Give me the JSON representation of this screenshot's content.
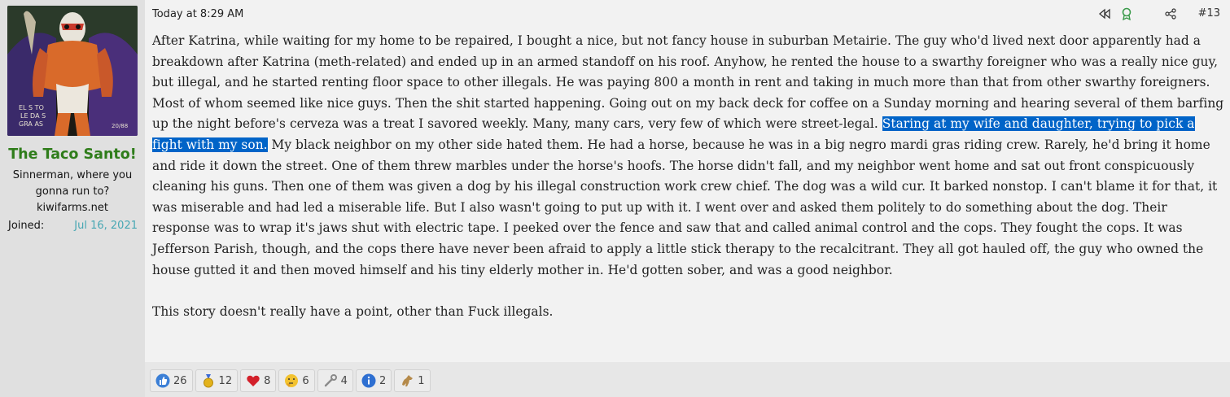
{
  "user": {
    "name": "The Taco Santo!",
    "title": "Sinnerman, where you gonna run to?",
    "banner": "kiwifarms.net",
    "joined_label": "Joined:",
    "joined_date": "Jul 16, 2021",
    "avatar_text": "EL SANTO LE DA LAS GRACIAS",
    "avatar_signature": "20/88"
  },
  "post": {
    "timestamp": "Today at 8:29 AM",
    "number": "#13",
    "icons": [
      "rewind-icon",
      "award-ribbon-icon",
      "share-icon"
    ],
    "text_before": "After Katrina, while waiting for my home to be repaired, I bought a nice, but not fancy house in suburban Metairie. The guy who'd lived next door apparently had a breakdown after Katrina (meth-related) and ended up in an armed standoff on his roof. Anyhow, he rented the house to a swarthy foreigner who was a really nice guy, but illegal, and he started renting floor space to other illegals. He was paying 800 a month in rent and taking in much more than that from other swarthy foreigners. Most of whom seemed like nice guys. Then the shit started happening. Going out on my back deck for coffee on a Sunday morning and hearing several of them barfing up the night before's cerveza was a treat I savored weekly. Many, many cars, very few of which were street-legal. ",
    "text_highlight": "Staring at my wife and daughter, trying to pick a fight with my son.",
    "text_after": " My black neighbor on my other side hated them. He had a horse, because he was in a big negro mardi gras riding crew. Rarely, he'd bring it home and ride it down the street. One of them threw marbles under the horse's hoofs. The horse didn't fall, and my neighbor went home and sat out front conspicuously cleaning his guns. Then one of them was given a dog by his illegal construction work crew chief. The dog was a wild cur. It barked nonstop. I can't blame it for that, it was miserable and had led a miserable life. But I also wasn't going to put up with it. I went over and asked them politely to do something about the dog. Their response was to wrap it's jaws shut with electric tape. I peeked over the fence and saw that and called animal control and the cops. They fought the cops. It was Jefferson Parish, though, and the cops there have never been afraid to apply a little stick therapy to the recalcitrant. They all got hauled off, the guy who owned the house gutted it and then moved himself and his tiny elderly mother in. He'd gotten sober, and was a good neighbor.",
    "closing": "This story doesn't really have a point, other than Fuck illegals."
  },
  "reactions": [
    {
      "icon": "thumbs-up-icon",
      "count": "26",
      "color": "#3b7fd6"
    },
    {
      "icon": "medal-icon",
      "count": "12",
      "color": "#e3b21b"
    },
    {
      "icon": "heart-icon",
      "count": "8",
      "color": "#d3202a"
    },
    {
      "icon": "thinking-face-icon",
      "count": "6",
      "color": "#f2c230"
    },
    {
      "icon": "wrench-icon",
      "count": "4",
      "color": "#8a8a8a"
    },
    {
      "icon": "info-icon",
      "count": "2",
      "color": "#2e6fd1"
    },
    {
      "icon": "horse-icon",
      "count": "1",
      "color": "#b58a4a"
    }
  ]
}
